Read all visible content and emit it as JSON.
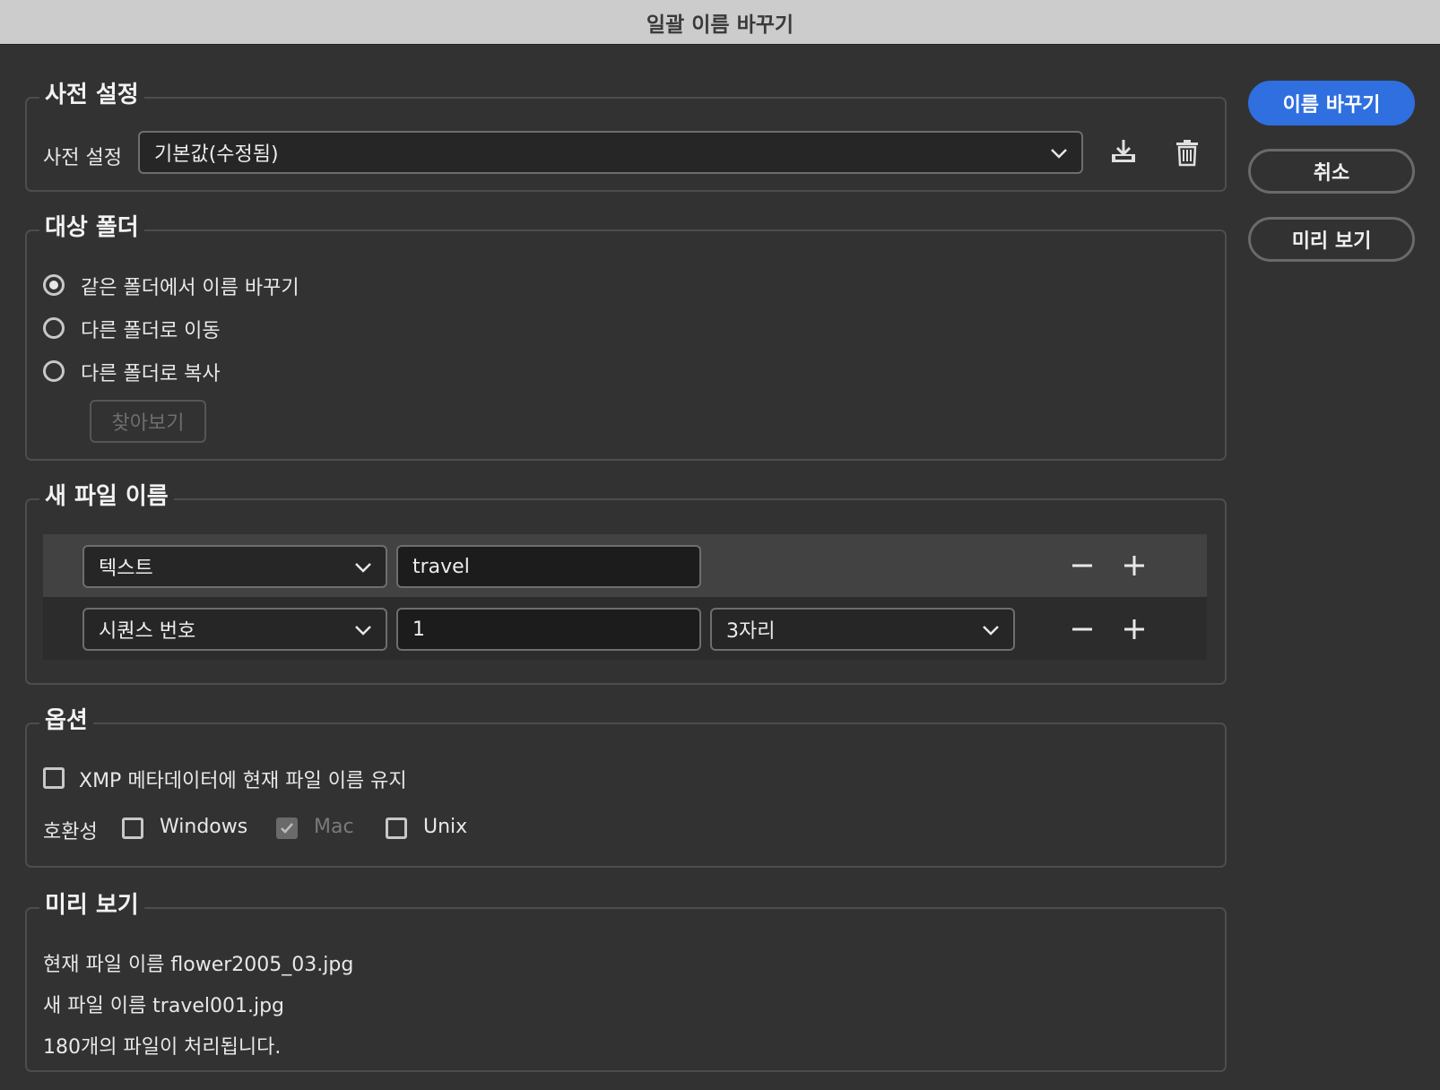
{
  "window": {
    "title": "일괄 이름 바꾸기"
  },
  "actions": {
    "rename": "이름 바꾸기",
    "cancel": "취소",
    "preview": "미리 보기"
  },
  "preset": {
    "section_title": "사전 설정",
    "label": "사전 설정",
    "value": "기본값(수정됨)",
    "save_icon": "save-download-icon",
    "delete_icon": "trash-icon"
  },
  "destination": {
    "section_title": "대상 폴더",
    "options": [
      {
        "label": "같은 폴더에서 이름 바꾸기",
        "selected": true
      },
      {
        "label": "다른 폴더로 이동",
        "selected": false
      },
      {
        "label": "다른 폴더로 복사",
        "selected": false
      }
    ],
    "browse_label": "찾아보기"
  },
  "new_name": {
    "section_title": "새 파일 이름",
    "rows": [
      {
        "type": "텍스트",
        "value": "travel",
        "extra": ""
      },
      {
        "type": "시퀀스 번호",
        "value": "1",
        "extra": "3자리"
      }
    ]
  },
  "options": {
    "section_title": "옵션",
    "keep_xmp_label": "XMP 메타데이터에 현재 파일 이름 유지",
    "keep_xmp_checked": false,
    "compat_label": "호환성",
    "compat": [
      {
        "label": "Windows",
        "checked": false,
        "disabled": false
      },
      {
        "label": "Mac",
        "checked": true,
        "disabled": true
      },
      {
        "label": "Unix",
        "checked": false,
        "disabled": false
      }
    ]
  },
  "preview": {
    "section_title": "미리 보기",
    "current_name": "현재 파일 이름 flower2005_03.jpg",
    "new_name": "새 파일 이름 travel001.jpg",
    "count_text": "180개의 파일이 처리됩니다."
  },
  "colors": {
    "background": "#323232",
    "titlebar": "#cccccc",
    "accent": "#2f6fe0"
  }
}
